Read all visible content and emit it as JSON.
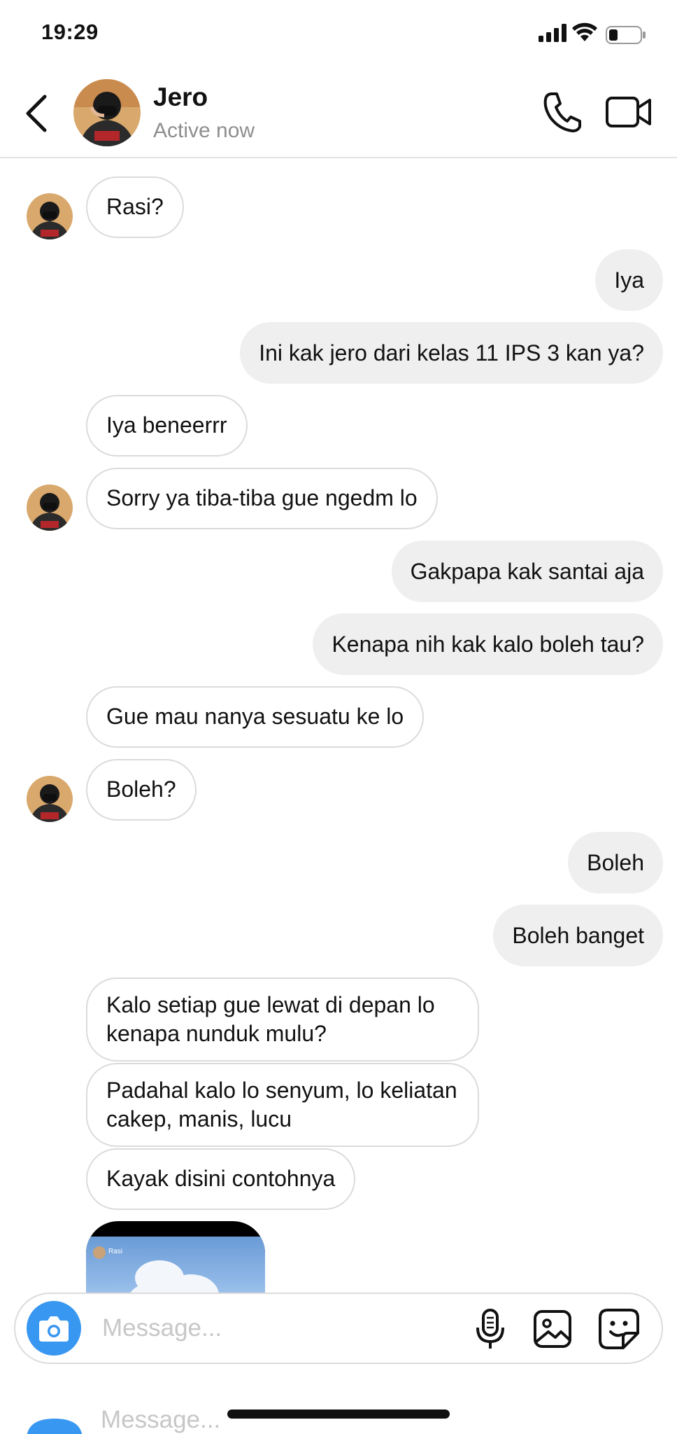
{
  "status_bar": {
    "time": "19:29"
  },
  "header": {
    "contact_name": "Jero",
    "contact_status": "Active now",
    "avatar_icon": "profile-photo"
  },
  "messages": [
    {
      "side": "received",
      "text": "Rasi?"
    },
    {
      "side": "sent",
      "text": "Iya"
    },
    {
      "side": "sent",
      "text": "Ini kak jero dari kelas 11 IPS 3 kan ya?"
    },
    {
      "side": "received",
      "text": "Iya beneerrr"
    },
    {
      "side": "received",
      "text": "Sorry ya tiba-tiba gue ngedm lo"
    },
    {
      "side": "sent",
      "text": "Gakpapa kak santai aja"
    },
    {
      "side": "sent",
      "text": "Kenapa nih kak kalo boleh tau?"
    },
    {
      "side": "received",
      "text": "Gue mau nanya sesuatu ke lo"
    },
    {
      "side": "received",
      "text": "Boleh?"
    },
    {
      "side": "sent",
      "text": "Boleh"
    },
    {
      "side": "sent",
      "text": "Boleh banget"
    },
    {
      "side": "received",
      "text": "Kalo setiap gue lewat di depan lo kenapa nunduk mulu?"
    },
    {
      "side": "received",
      "text": "Padahal kalo lo senyum, lo keliatan cakep, manis, lucu"
    },
    {
      "side": "received",
      "text": "Kayak disini contohnya"
    }
  ],
  "shared_post": {
    "username": "Rasi"
  },
  "composer": {
    "placeholder": "Message...",
    "ghost_placeholder": "Message..."
  },
  "colors": {
    "accent": "#3897f0",
    "sent_bubble": "#efefef",
    "received_border": "#dbdbdb",
    "muted_text": "#8e8e8e"
  }
}
